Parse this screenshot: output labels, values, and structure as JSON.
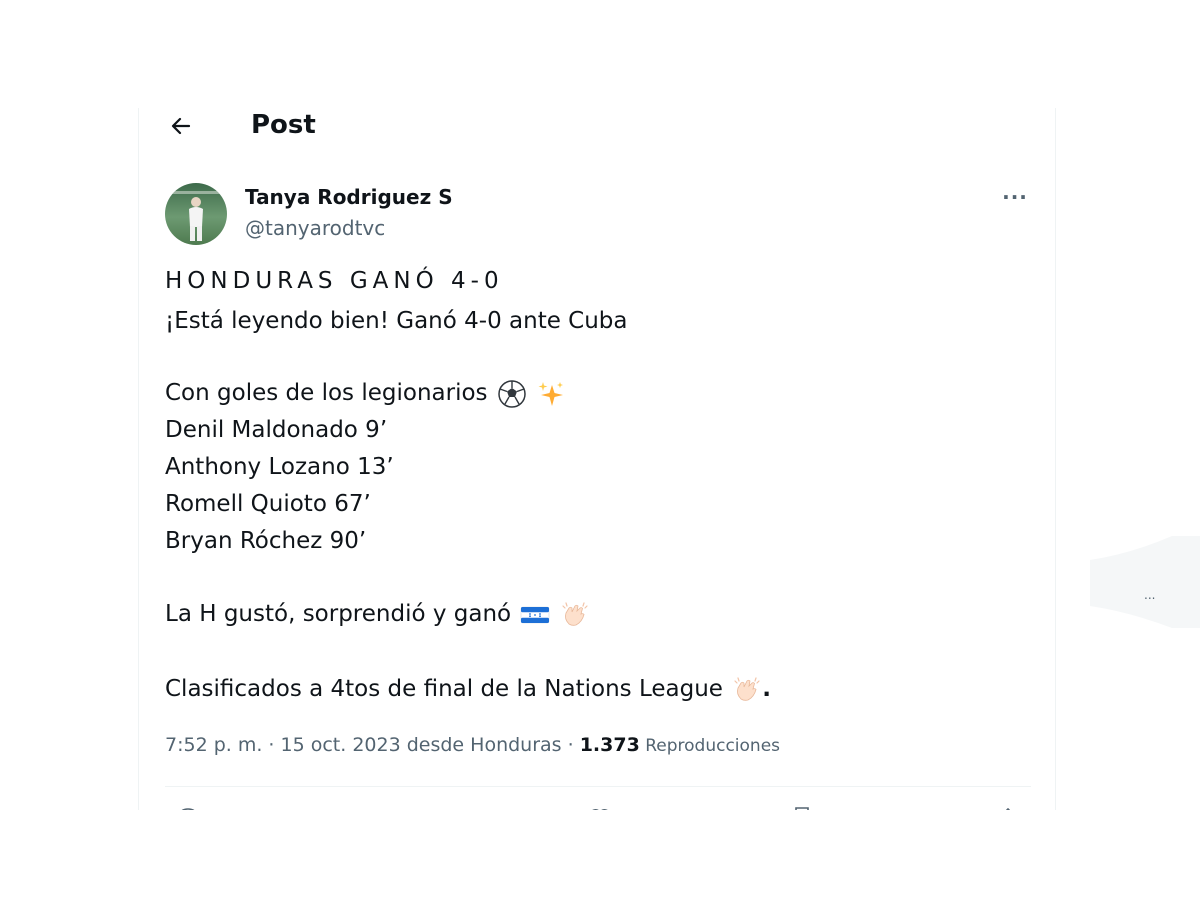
{
  "header": {
    "title": "Post",
    "back_icon": "arrow-left-icon"
  },
  "author": {
    "name": "Tanya Rodriguez S",
    "handle": "@tanyarodtvc",
    "avatar_icon": "profile-photo"
  },
  "more_icon": "more-horizontal-icon",
  "more_label": "···",
  "tweet": {
    "headline": "HONDURAS GANÓ 4-0",
    "line1": "¡Está leyendo bien! Ganó 4-0 ante Cuba",
    "line2": "Con goles de los legionarios",
    "scorers": [
      "Denil Maldonado 9’",
      "Anthony Lozano 13’",
      "Romell Quioto 67’",
      "Bryan Róchez 90’"
    ],
    "line3": "La H gustó, sorprendió y ganó",
    "line4": "Clasificados a 4tos de final de la Nations League",
    "line4_end": ".",
    "emojis": [
      "soccer-ball-icon",
      "sparkles-icon",
      "honduras-flag-icon",
      "clapping-hands-icon"
    ]
  },
  "meta": {
    "timestamp": "7:52 p. m. · 15 oct. 2023 desde Honduras · ",
    "views_count": "1.373",
    "views_label": " Reproducciones"
  },
  "side_panel": {
    "dots": "..."
  },
  "colors": {
    "text": "#0f1419",
    "secondary": "#536471",
    "divider": "#eff3f4",
    "flag_blue": "#1d6fd6"
  }
}
